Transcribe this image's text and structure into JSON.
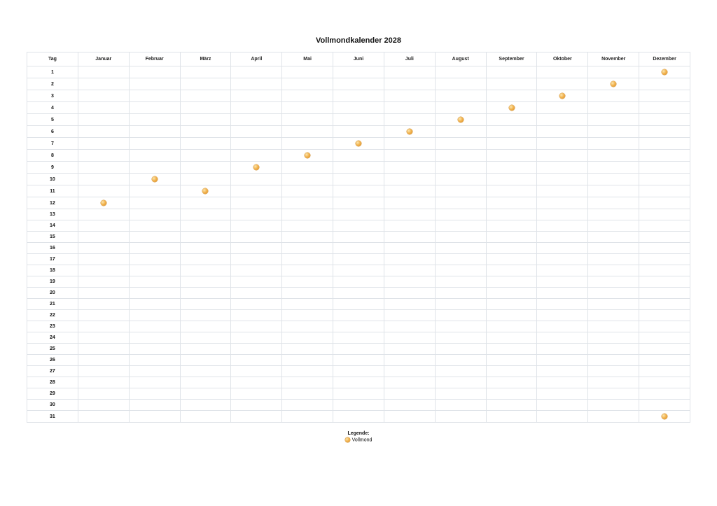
{
  "title": "Vollmondkalender 2028",
  "header": {
    "day_col": "Tag",
    "months": [
      "Januar",
      "Februar",
      "März",
      "April",
      "Mai",
      "Juni",
      "Juli",
      "August",
      "September",
      "Oktober",
      "November",
      "Dezember"
    ]
  },
  "days": [
    1,
    2,
    3,
    4,
    5,
    6,
    7,
    8,
    9,
    10,
    11,
    12,
    13,
    14,
    15,
    16,
    17,
    18,
    19,
    20,
    21,
    22,
    23,
    24,
    25,
    26,
    27,
    28,
    29,
    30,
    31
  ],
  "full_moons": [
    {
      "month": "Januar",
      "day": 12
    },
    {
      "month": "Februar",
      "day": 10
    },
    {
      "month": "März",
      "day": 11
    },
    {
      "month": "April",
      "day": 9
    },
    {
      "month": "Mai",
      "day": 8
    },
    {
      "month": "Juni",
      "day": 7
    },
    {
      "month": "Juli",
      "day": 6
    },
    {
      "month": "August",
      "day": 5
    },
    {
      "month": "September",
      "day": 4
    },
    {
      "month": "Oktober",
      "day": 3
    },
    {
      "month": "November",
      "day": 2
    },
    {
      "month": "Dezember",
      "day": 1
    },
    {
      "month": "Dezember",
      "day": 31
    }
  ],
  "legend": {
    "title": "Legende:",
    "items": [
      {
        "icon": "full-moon-icon",
        "label": "Vollmond"
      }
    ]
  }
}
